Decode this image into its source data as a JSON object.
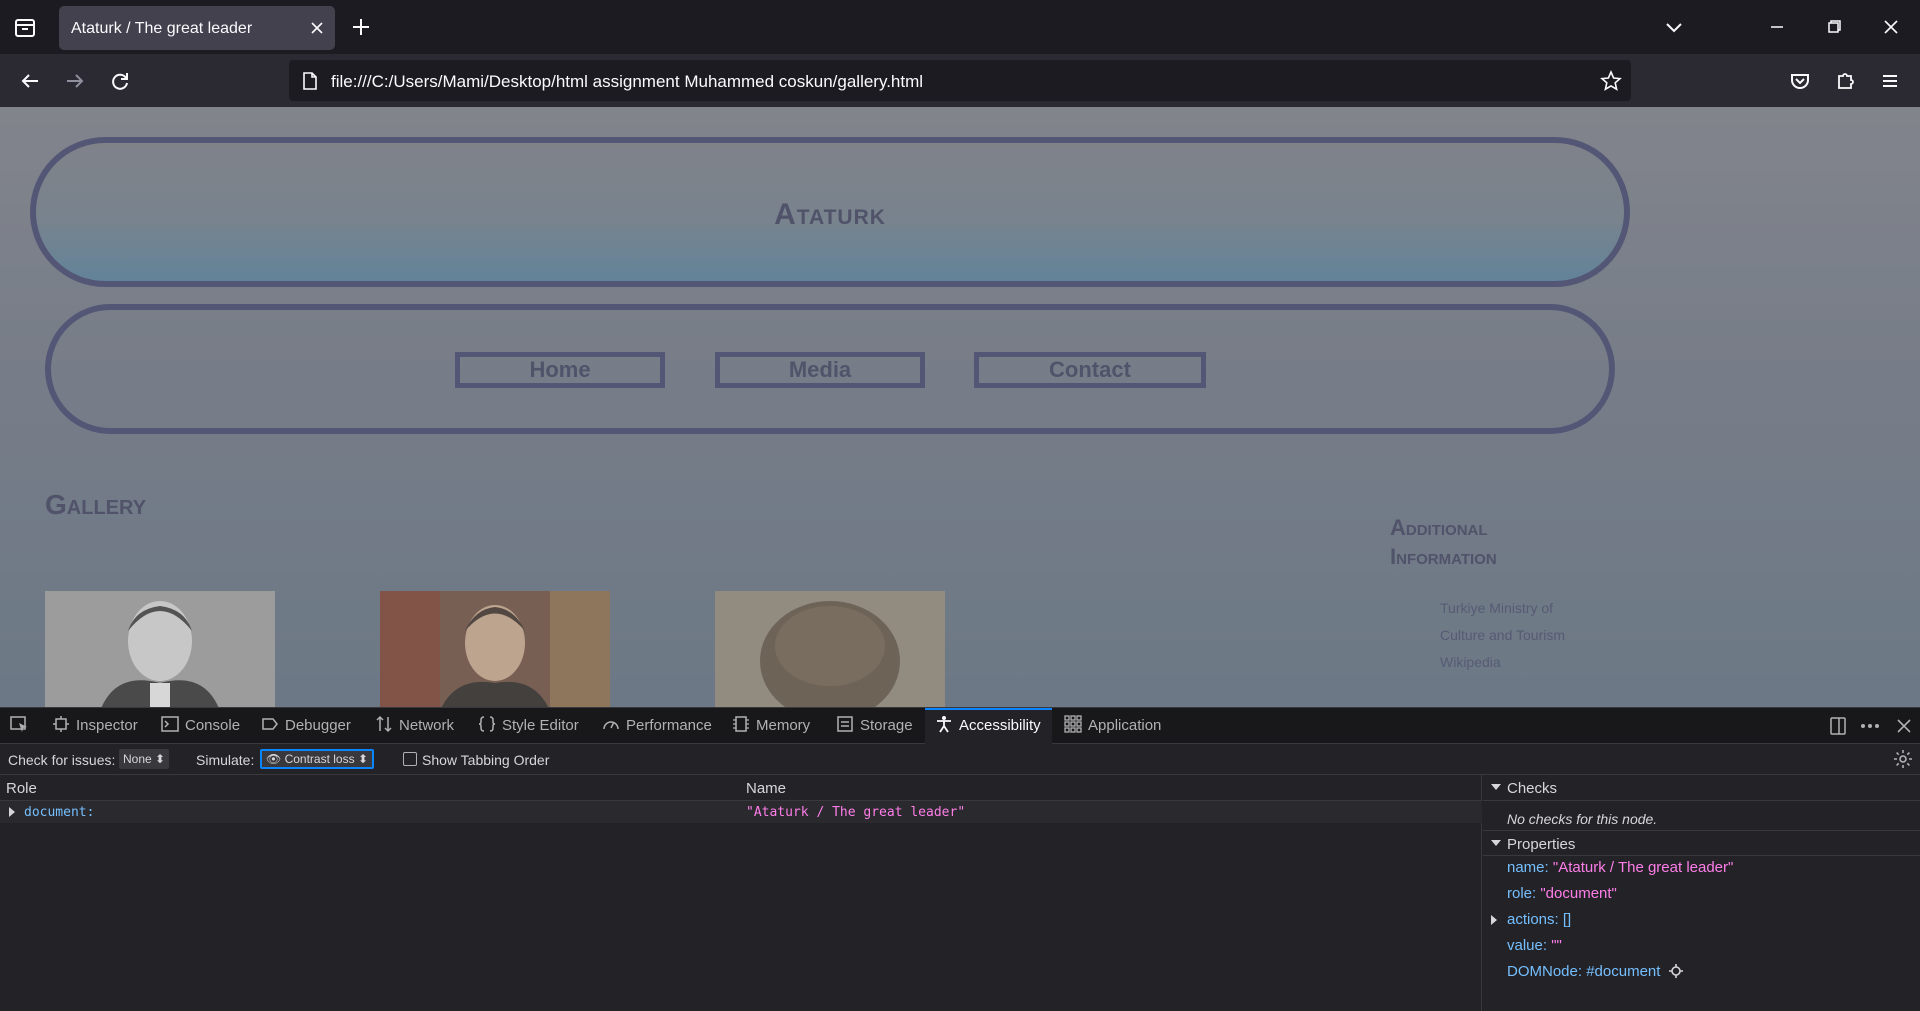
{
  "browser": {
    "tab_title": "Ataturk / The great leader",
    "url": "file:///C:/Users/Mami/Desktop/html assignment Muhammed coskun/gallery.html"
  },
  "page": {
    "site_title": "Ataturk",
    "nav": [
      "Home",
      "Media",
      "Contact"
    ],
    "gallery_title": "Gallery",
    "additional_title_line1": "Additional",
    "additional_title_line2": "Information",
    "additional_links": [
      "Turkiye Ministry of",
      "Culture and Tourism",
      "Wikipedia"
    ]
  },
  "devtools": {
    "tabs": [
      "Inspector",
      "Console",
      "Debugger",
      "Network",
      "Style Editor",
      "Performance",
      "Memory",
      "Storage",
      "Accessibility",
      "Application"
    ],
    "active_tab": "Accessibility",
    "check_for_issues_label": "Check for issues:",
    "check_for_issues_value": "None",
    "simulate_label": "Simulate:",
    "simulate_value": "Contrast loss",
    "show_tabbing_order": "Show Tabbing Order",
    "columns": {
      "role": "Role",
      "name": "Name"
    },
    "tree_row": {
      "role": "document:",
      "name": "\"Ataturk / The great leader\""
    },
    "checks": {
      "title": "Checks",
      "message": "No checks for this node."
    },
    "properties": {
      "title": "Properties",
      "name_key": "name:",
      "name_val": "\"Ataturk / The great leader\"",
      "role_key": "role:",
      "role_val": "\"document\"",
      "actions_key": "actions:",
      "actions_val": "[]",
      "value_key": "value:",
      "value_val": "\"\"",
      "domnode_key": "DOMNode:",
      "domnode_val": "#document"
    }
  },
  "colors": {
    "accent": "#0a84ff",
    "page_border": "#3c3f6a",
    "string": "#ff7de9",
    "key": "#75bfff"
  }
}
